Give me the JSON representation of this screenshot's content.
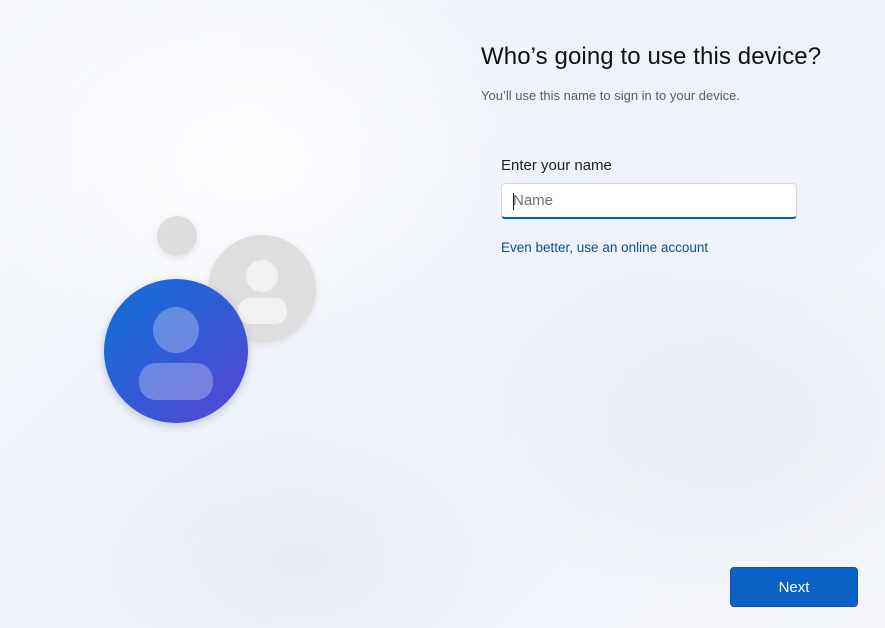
{
  "page": {
    "title": "Who’s going to use this device?",
    "subtitle": "You’ll use this name to sign in to your device."
  },
  "form": {
    "label": "Enter your name",
    "name_placeholder": "Name",
    "name_value": ""
  },
  "links": {
    "online_account": "Even better, use an online account"
  },
  "actions": {
    "next_label": "Next"
  },
  "colors": {
    "accent": "#0a62c4",
    "link": "#0b4d8f",
    "avatar_primary_start": "#0d6fd6",
    "avatar_primary_end": "#5b46d6",
    "avatar_secondary": "#dcdcdc"
  },
  "icons": {
    "illustration": "users-avatars-icon"
  }
}
